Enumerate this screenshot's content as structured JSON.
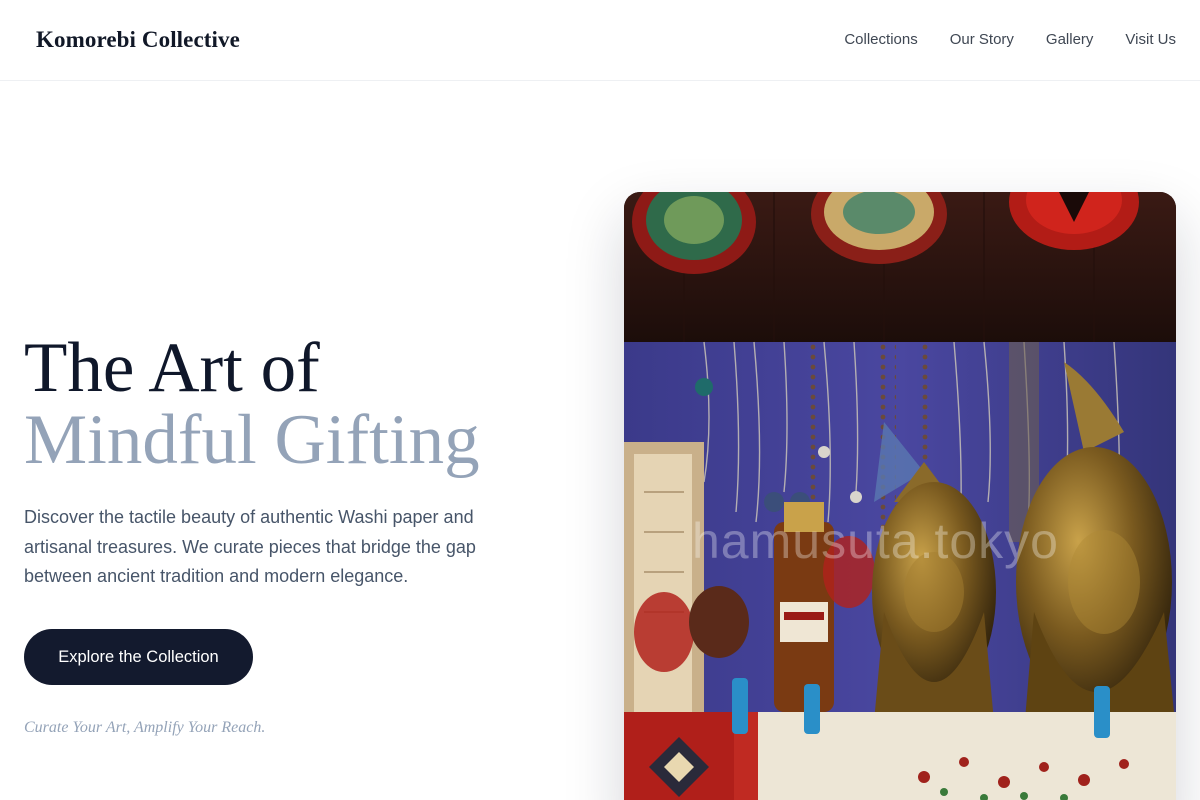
{
  "header": {
    "brand": "Komorebi Collective",
    "nav": [
      "Collections",
      "Our Story",
      "Gallery",
      "Visit Us"
    ]
  },
  "hero": {
    "title_line1": "The Art of",
    "title_line2": "Mindful Gifting",
    "description": "Discover the tactile beauty of authentic Washi paper and artisanal treasures. We curate pieces that bridge the gap between ancient tradition and modern elegance.",
    "cta_label": "Explore the Collection",
    "tagline": "Curate Your Art, Amplify Your Reach.",
    "image_watermark": "hamusuta.tokyo"
  },
  "colors": {
    "primary_dark": "#131a2e",
    "title_dark": "#0f172a",
    "title_accent": "#94a3b8",
    "body_text": "#475569",
    "nav_text": "#3f4753"
  }
}
